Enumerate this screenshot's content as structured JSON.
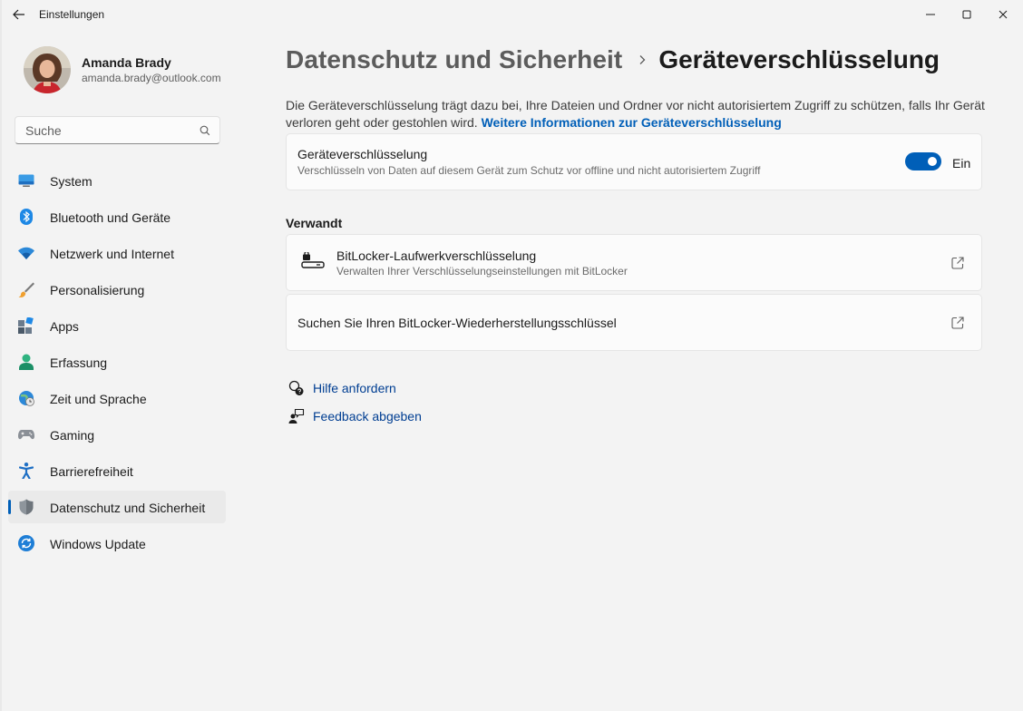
{
  "window": {
    "title": "Einstellungen"
  },
  "profile": {
    "name": "Amanda Brady",
    "email": "amanda.brady@outlook.com"
  },
  "search": {
    "placeholder": "Suche"
  },
  "nav": {
    "items": [
      {
        "label": "System",
        "icon": "monitor-icon"
      },
      {
        "label": "Bluetooth und Geräte",
        "icon": "bluetooth-icon"
      },
      {
        "label": "Netzwerk und Internet",
        "icon": "wifi-icon"
      },
      {
        "label": "Personalisierung",
        "icon": "brush-icon"
      },
      {
        "label": "Apps",
        "icon": "apps-icon"
      },
      {
        "label": "Erfassung",
        "icon": "person-icon"
      },
      {
        "label": "Zeit und Sprache",
        "icon": "globe-clock-icon"
      },
      {
        "label": "Gaming",
        "icon": "gamepad-icon"
      },
      {
        "label": "Barrierefreiheit",
        "icon": "accessibility-icon"
      },
      {
        "label": "Datenschutz und Sicherheit",
        "icon": "shield-icon",
        "active": true
      },
      {
        "label": "Windows Update",
        "icon": "sync-icon"
      }
    ]
  },
  "breadcrumb": {
    "parent": "Datenschutz und Sicherheit",
    "current": "Geräteverschlüsselung"
  },
  "intro": {
    "text": "Die Geräteverschlüsselung trägt dazu bei, Ihre Dateien und Ordner vor nicht autorisiertem Zugriff zu schützen, falls Ihr Gerät verloren geht oder gestohlen wird.",
    "link": "Weitere Informationen zur Geräteverschlüsselung"
  },
  "encryption_card": {
    "title": "Geräteverschlüsselung",
    "subtitle": "Verschlüsseln von Daten auf diesem Gerät zum Schutz vor offline und nicht autorisiertem Zugriff",
    "toggle_state": "Ein",
    "toggle_on": true
  },
  "related": {
    "heading": "Verwandt",
    "items": [
      {
        "title": "BitLocker-Laufwerkverschlüsselung",
        "subtitle": "Verwalten Ihrer Verschlüsselungseinstellungen mit BitLocker"
      },
      {
        "title": "Suchen Sie Ihren BitLocker-Wiederherstellungsschlüssel"
      }
    ]
  },
  "help": {
    "get_help": "Hilfe anfordern",
    "feedback": "Feedback abgeben"
  },
  "colors": {
    "accent": "#005fb8",
    "link": "#003e92"
  }
}
